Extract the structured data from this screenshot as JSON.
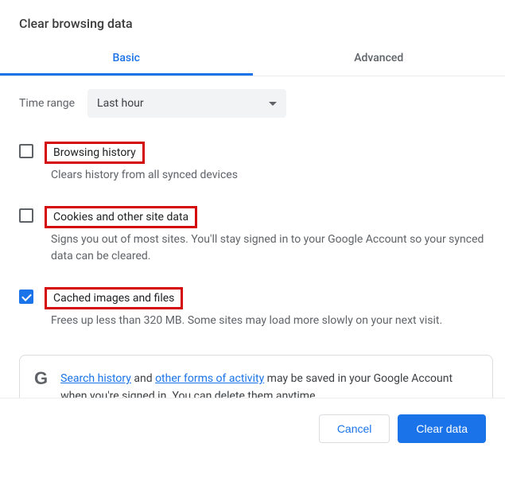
{
  "title": "Clear browsing data",
  "tabs": {
    "basic": "Basic",
    "advanced": "Advanced"
  },
  "timeRange": {
    "label": "Time range",
    "value": "Last hour"
  },
  "options": {
    "history": {
      "title": "Browsing history",
      "desc": "Clears history from all synced devices",
      "checked": false
    },
    "cookies": {
      "title": "Cookies and other site data",
      "desc": "Signs you out of most sites. You'll stay signed in to your Google Account so your synced data can be cleared.",
      "checked": false
    },
    "cache": {
      "title": "Cached images and files",
      "desc": "Frees up less than 320 MB. Some sites may load more slowly on your next visit.",
      "checked": true
    }
  },
  "notice": {
    "link1": "Search history",
    "mid1": " and ",
    "link2": "other forms of activity",
    "rest": " may be saved in your Google Account when you're signed in. You can delete them anytime."
  },
  "buttons": {
    "cancel": "Cancel",
    "clear": "Clear data"
  }
}
